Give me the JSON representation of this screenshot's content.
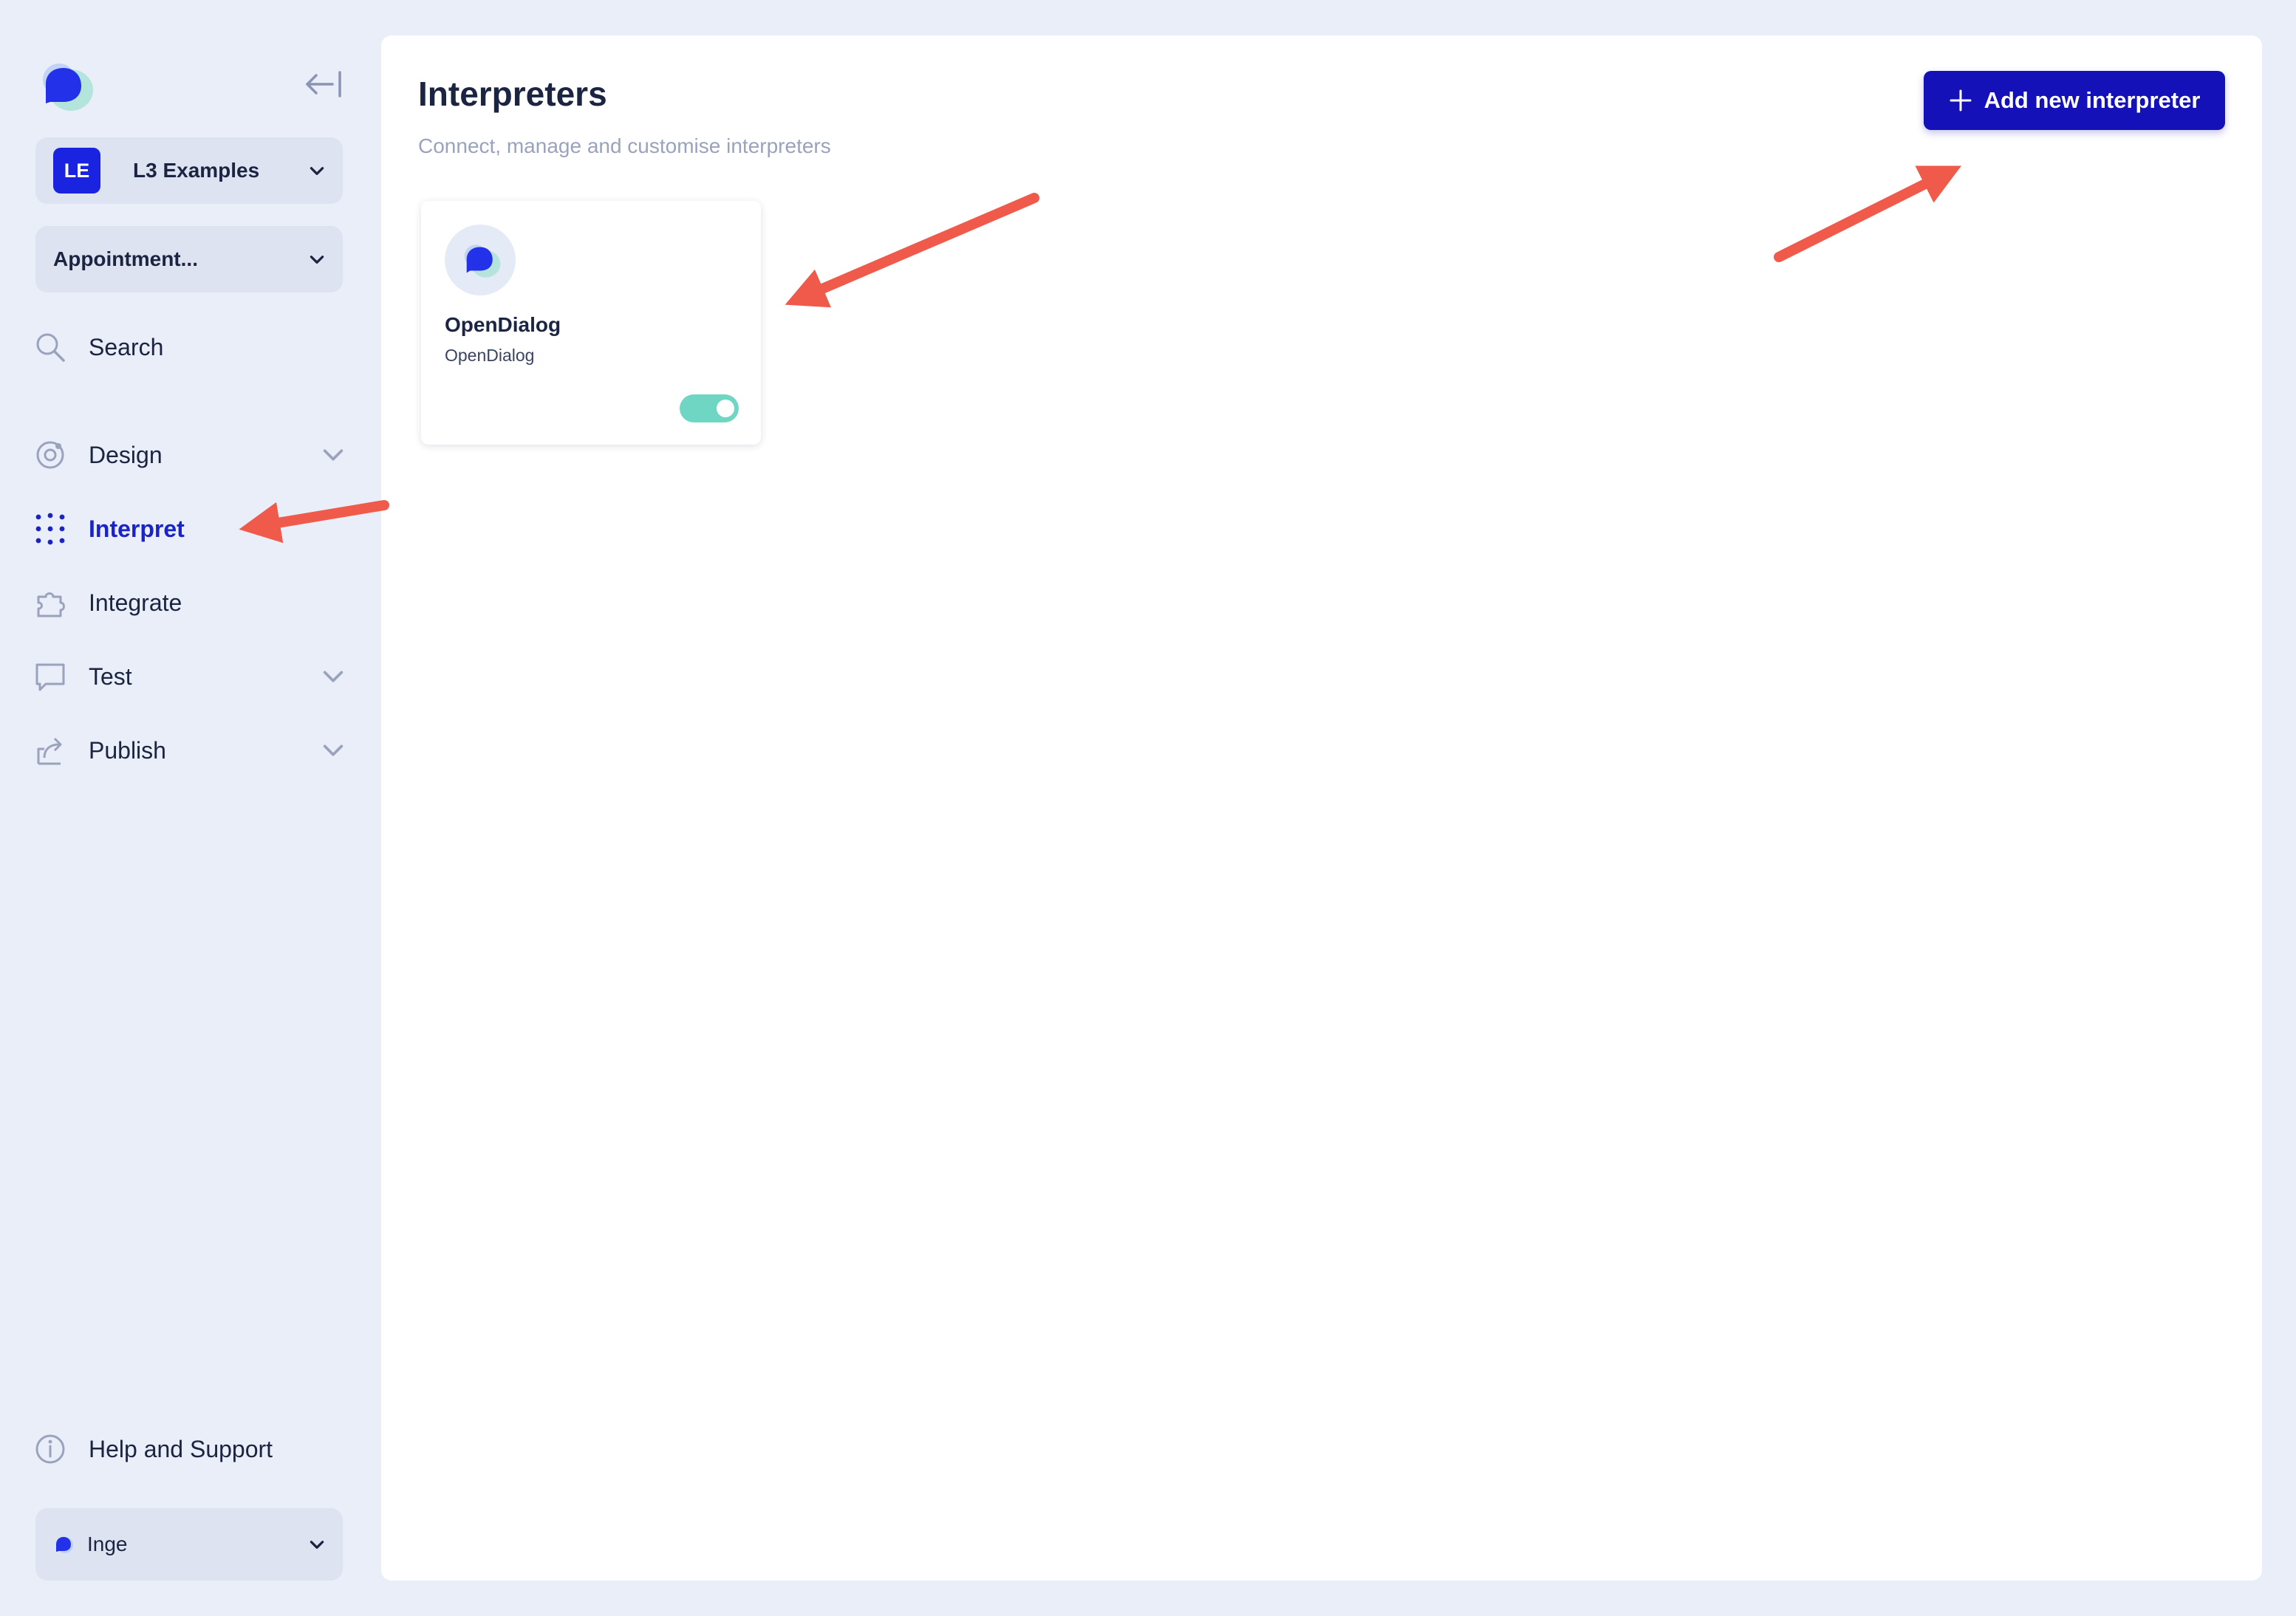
{
  "sidebar": {
    "workspace": {
      "initials": "LE",
      "name": "L3 Examples"
    },
    "scenario": {
      "label": "Appointment..."
    },
    "search": {
      "label": "Search"
    },
    "nav": {
      "design": "Design",
      "interpret": "Interpret",
      "integrate": "Integrate",
      "test": "Test",
      "publish": "Publish"
    },
    "help": {
      "label": "Help and Support"
    },
    "user": {
      "name": "Inge"
    }
  },
  "main": {
    "title": "Interpreters",
    "subtitle": "Connect, manage and customise interpreters",
    "add_button_label": "Add new interpreter",
    "interpreters": [
      {
        "name": "OpenDialog",
        "provider": "OpenDialog",
        "enabled": true
      }
    ]
  },
  "colors": {
    "accent": "#1a23e0",
    "primary_button": "#1411b8",
    "toggle_on": "#6fd6c4",
    "annotation_arrow": "#ef5a4a",
    "background": "#e9eef8"
  }
}
